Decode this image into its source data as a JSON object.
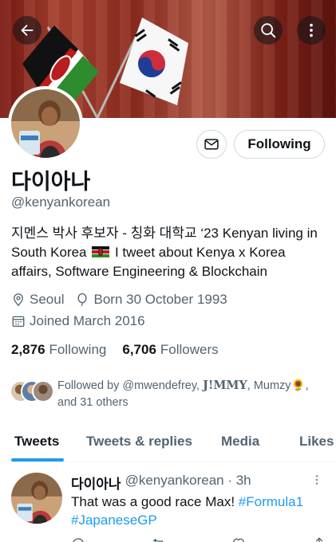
{
  "header": {
    "back_icon": "arrow-left-icon",
    "search_icon": "search-icon",
    "more_icon": "more-vertical-icon"
  },
  "profile": {
    "display_name": "다이아나",
    "handle": "@kenyankorean",
    "bio_part1": "지멘스 박사 후보자 - 칭화 대학교 ‘23 Kenyan living in South Korea",
    "bio_part2": " I tweet about Kenya x Korea affairs, Software Engineering & Blockchain",
    "location": "Seoul",
    "birthday": "Born 30 October 1993",
    "joined": "Joined March 2016",
    "following_count": "2,876",
    "following_label": "Following",
    "followers_count": "6,706",
    "followers_label": "Followers",
    "followed_by_prefix": "Followed by @mwendefrey, ",
    "followed_by_jmmy": "J!MMY",
    "followed_by_rest": ", Mumzy🌻, and 31 others"
  },
  "actions": {
    "message_icon": "envelope-icon",
    "follow_button_label": "Following"
  },
  "tabs": [
    {
      "label": "Tweets",
      "active": true
    },
    {
      "label": "Tweets & replies",
      "active": false
    },
    {
      "label": "Media",
      "active": false
    },
    {
      "label": "Likes",
      "active": false
    }
  ],
  "tweet": {
    "name": "다이아나",
    "handle_time": "@kenyankorean · 3h",
    "text": "That was a good race Max! ",
    "hashtag1": "#Formula1",
    "hashtag2": "#JapaneseGP"
  },
  "colors": {
    "accent": "#1d9bf0",
    "text_primary": "#0f1419",
    "text_secondary": "#536471",
    "border": "#cfd9de"
  }
}
